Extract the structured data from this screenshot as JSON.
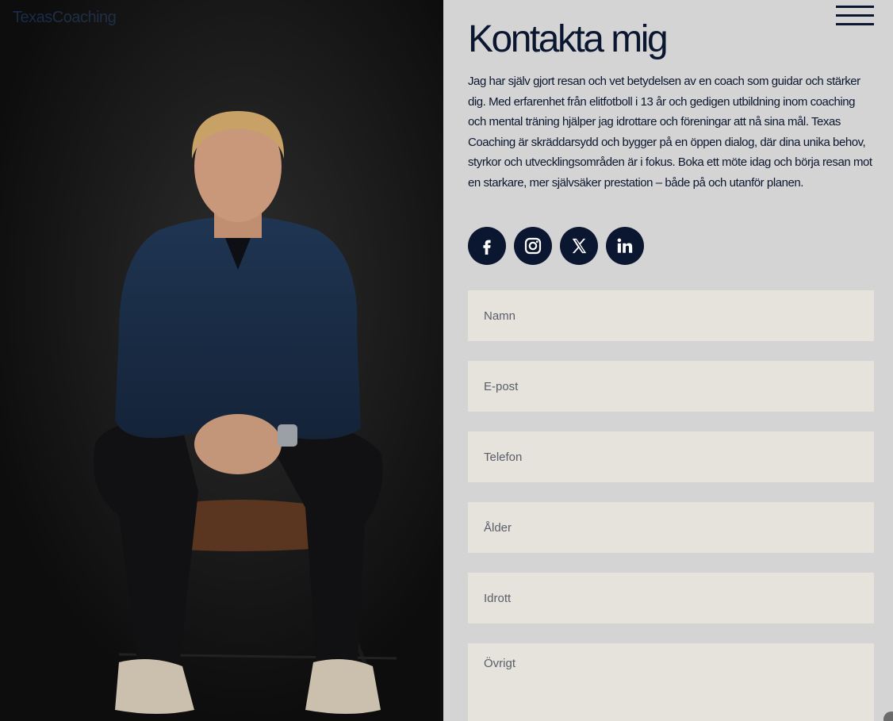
{
  "brand": {
    "logo_part1": "Texas",
    "logo_part2": "Coaching"
  },
  "header": {
    "menu_icon": "hamburger-menu-icon"
  },
  "contact": {
    "title": "Kontakta mig",
    "intro": "Jag har själv gjort resan och vet betydelsen av en coach som guidar och stärker dig. Med erfarenhet från elitfotboll i 13 år och gedigen utbildning inom coaching och mental träning hjälper jag idrottare och föreningar att nå sina mål. Texas Coaching är skräddarsydd och bygger på en öppen dialog, där dina unika behov, styrkor och utvecklingsområden är i fokus. Boka ett möte idag och börja resan mot en starkare, mer självsäker prestation – både på och utanför planen."
  },
  "socials": [
    {
      "name": "facebook-icon"
    },
    {
      "name": "instagram-icon"
    },
    {
      "name": "x-twitter-icon"
    },
    {
      "name": "linkedin-icon"
    }
  ],
  "form": {
    "name_placeholder": "Namn",
    "email_placeholder": "E-post",
    "phone_placeholder": "Telefon",
    "age_placeholder": "Ålder",
    "sport_placeholder": "Idrott",
    "other_placeholder": "Övrigt"
  },
  "colors": {
    "panel_bg": "#d4d4d4",
    "navy": "#0b1730",
    "field_bg": "#e6e2dc"
  }
}
